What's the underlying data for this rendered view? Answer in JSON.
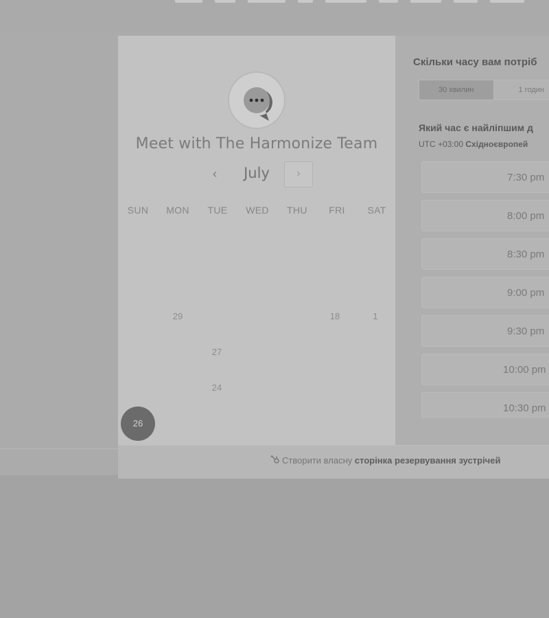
{
  "widget": {
    "title": "Meet with The Harmonize Team",
    "calendar": {
      "month": "July",
      "prev_icon": "‹",
      "next_icon": "›",
      "weekdays": [
        "SUN",
        "MON",
        "TUE",
        "WED",
        "THU",
        "FRI",
        "SAT"
      ],
      "days": {
        "d29": "29",
        "d18": "18",
        "d1": "1",
        "d27": "27",
        "d24": "24",
        "d26": "26"
      },
      "selected_day": "26"
    },
    "duration": {
      "question": "Скільки часу вам потріб",
      "options": [
        "30 хвилин",
        "1 годин"
      ],
      "active_option": "30 хвилин"
    },
    "times": {
      "question": "Який час є найліпшим д",
      "timezone_prefix": "UTC +03:00",
      "timezone_name": "Східноєвропей",
      "slots": [
        "7:30 pm",
        "8:00 pm",
        "8:30 pm",
        "9:00 pm",
        "9:30 pm",
        "10:00 pm",
        "10:30 pm"
      ]
    },
    "footer": {
      "prefix": "Створити власну",
      "link": "сторінка резервування зустрічей"
    }
  },
  "colors": {
    "selected_day_bg": "#6b6b6b",
    "left_panel_bg": "#c2c2c2",
    "right_panel_bg": "#afafaf"
  },
  "icons": {
    "avatar": "chat-bubble-icon",
    "prev": "chevron-left-icon",
    "next": "chevron-right-icon",
    "footer": "sprocket-icon"
  }
}
